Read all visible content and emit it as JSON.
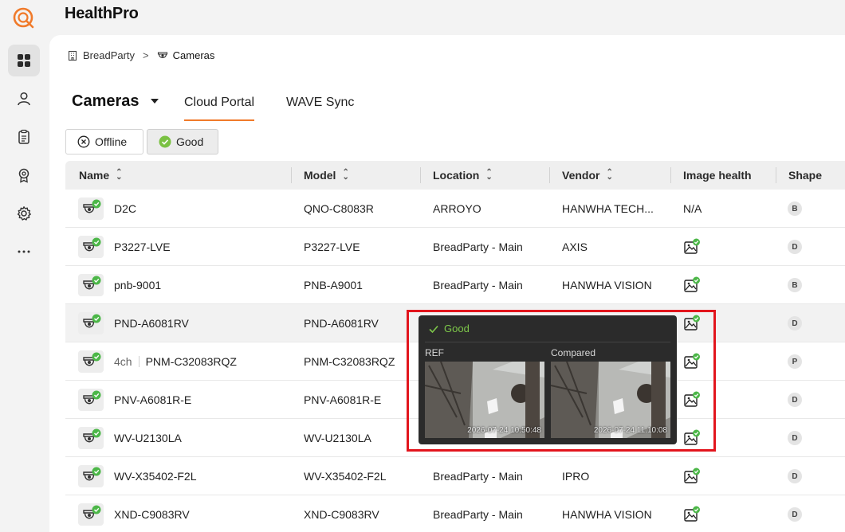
{
  "app": {
    "title": "HealthPro"
  },
  "rail": {
    "items": [
      "dashboard",
      "users",
      "clipboard",
      "badge",
      "settings",
      "more"
    ]
  },
  "breadcrumb": {
    "parent": "BreadParty",
    "separator": ">",
    "current": "Cameras"
  },
  "page": {
    "title": "Cameras"
  },
  "tabs": [
    {
      "label": "Cloud Portal",
      "active": true
    },
    {
      "label": "WAVE Sync",
      "active": false
    }
  ],
  "filters": [
    {
      "label": "Offline",
      "icon": "x-circle-icon",
      "selected": false
    },
    {
      "label": "Good",
      "icon": "check-circle-icon",
      "selected": true
    }
  ],
  "table": {
    "columns": [
      "Name",
      "Model",
      "Location",
      "Vendor",
      "Image health",
      "Shape"
    ],
    "rows": [
      {
        "channel": "",
        "name": "D2C",
        "model": "QNO-C8083R",
        "location": "ARROYO",
        "vendor": "HANWHA TECH...",
        "health": "N/A",
        "shape": "B"
      },
      {
        "channel": "",
        "name": "P3227-LVE",
        "model": "P3227-LVE",
        "location": "BreadParty - Main",
        "vendor": "AXIS",
        "health": "image-good-icon",
        "shape": "D"
      },
      {
        "channel": "",
        "name": "pnb-9001",
        "model": "PNB-A9001",
        "location": "BreadParty - Main",
        "vendor": "HANWHA VISION",
        "health": "image-good-icon",
        "shape": "B"
      },
      {
        "channel": "",
        "name": "PND-A6081RV",
        "model": "PND-A6081RV",
        "location": "",
        "vendor": "",
        "health": "image-good-icon",
        "shape": "D"
      },
      {
        "channel": "4ch",
        "name": "PNM-C32083RQZ",
        "model": "PNM-C32083RQZ",
        "location": "",
        "vendor": "",
        "health": "image-good-icon",
        "shape": "P"
      },
      {
        "channel": "",
        "name": "PNV-A6081R-E",
        "model": "PNV-A6081R-E",
        "location": "",
        "vendor": "",
        "health": "image-good-icon",
        "shape": "D"
      },
      {
        "channel": "",
        "name": "WV-U2130LA",
        "model": "WV-U2130LA",
        "location": "",
        "vendor": "",
        "health": "image-good-icon",
        "shape": "D"
      },
      {
        "channel": "",
        "name": "WV-X35402-F2L",
        "model": "WV-X35402-F2L",
        "location": "BreadParty - Main",
        "vendor": "IPRO",
        "health": "image-good-icon",
        "shape": "D"
      },
      {
        "channel": "",
        "name": "XND-C9083RV",
        "model": "XND-C9083RV",
        "location": "BreadParty - Main",
        "vendor": "HANWHA VISION",
        "health": "image-good-icon",
        "shape": "D"
      }
    ]
  },
  "tooltip": {
    "status": "Good",
    "ref_label": "REF",
    "ref_timestamp": "2026-07-24 10:50:48",
    "compared_label": "Compared",
    "compared_timestamp": "2026-07-24 11:10:08"
  },
  "colors": {
    "accent": "#f07a2a",
    "good": "#4cb748",
    "highlight": "#e2151d",
    "tooltip_bg": "#2b2b2b"
  }
}
